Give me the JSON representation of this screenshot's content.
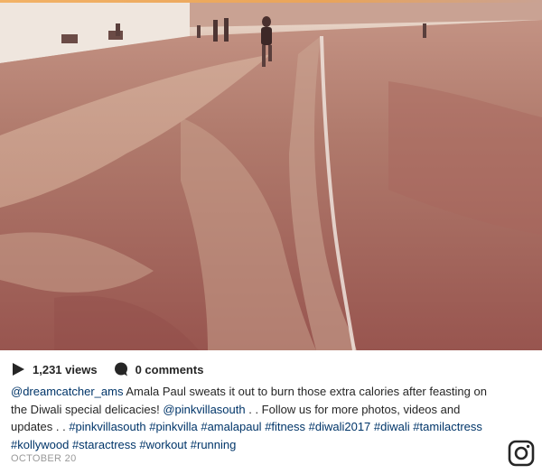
{
  "video": {
    "description_icon": "video-frame"
  },
  "stats": {
    "views_icon": "play-icon",
    "views_label": "1,231 views",
    "comments_icon": "comment-bubble-icon",
    "comments_label": "0 comments"
  },
  "caption": {
    "author": "@dreamcatcher_ams",
    "text_1": " Amala Paul sweats it out to burn those extra calories after feasting on the Diwali special delicacies! ",
    "mention": "@pinkvillasouth",
    "text_2": " . . Follow us for more photos, videos and updates . . ",
    "hashtags": [
      "#pinkvillasouth",
      "#pinkvilla",
      "#amalapaul",
      "#fitness",
      "#diwali2017",
      "#diwali",
      "#tamilactress",
      "#kollywood",
      "#staractress",
      "#workout",
      "#running"
    ]
  },
  "date": "OCTOBER 20",
  "logo": {
    "icon": "instagram-icon"
  },
  "colors": {
    "text": "#262626",
    "link": "#003569",
    "muted": "#999999",
    "accent": "#e9a45a"
  }
}
